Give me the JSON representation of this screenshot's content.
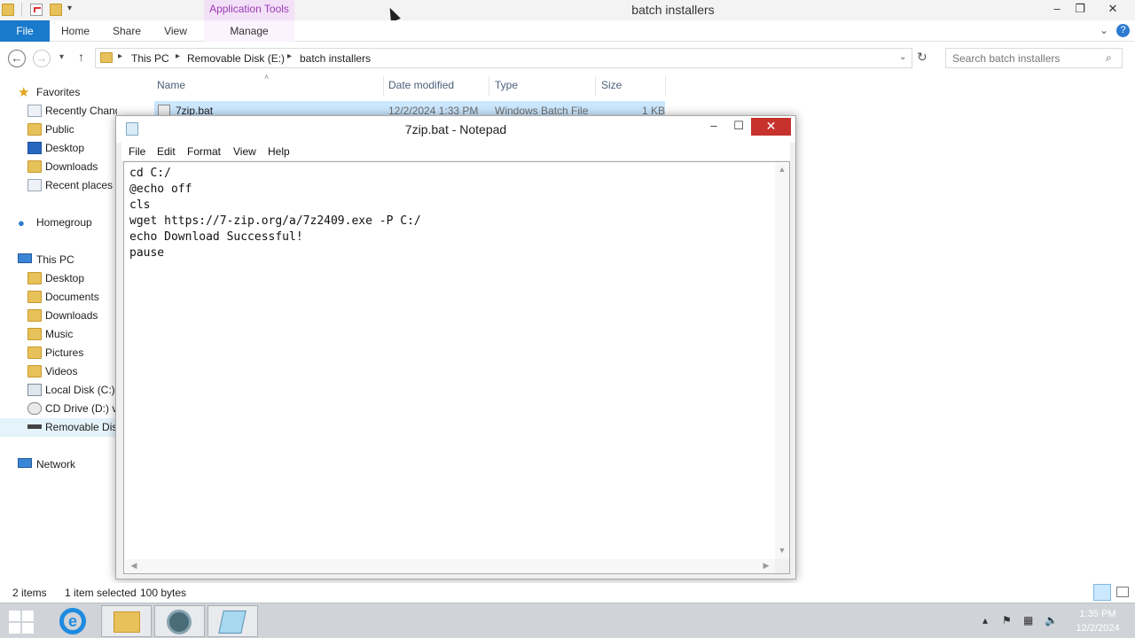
{
  "explorer": {
    "title": "batch installers",
    "context_tab": "Application Tools",
    "ribbon_tabs": {
      "file": "File",
      "home": "Home",
      "share": "Share",
      "view": "View",
      "manage": "Manage"
    },
    "breadcrumb": [
      "This PC",
      "Removable Disk (E:)",
      "batch installers"
    ],
    "search_placeholder": "Search batch installers",
    "nav": {
      "favorites": "Favorites",
      "recently_changed": "Recently Changed",
      "public": "Public",
      "desktop": "Desktop",
      "downloads": "Downloads",
      "recent_places": "Recent places",
      "homegroup": "Homegroup",
      "this_pc": "This PC",
      "pc_desktop": "Desktop",
      "documents": "Documents",
      "pc_downloads": "Downloads",
      "music": "Music",
      "pictures": "Pictures",
      "videos": "Videos",
      "local_disk": "Local Disk (C:)",
      "cd_drive": "CD Drive (D:) vi",
      "removable": "Removable Dis",
      "network": "Network"
    },
    "columns": {
      "name": "Name",
      "date_modified": "Date modified",
      "type": "Type",
      "size": "Size"
    },
    "file_row": {
      "name": "7zip.bat",
      "date": "12/2/2024 1:33 PM",
      "type": "Windows Batch File",
      "size": "1 KB"
    },
    "status": {
      "items": "2 items",
      "selected": "1 item selected",
      "bytes": "100 bytes"
    }
  },
  "notepad": {
    "title": "7zip.bat - Notepad",
    "menu": {
      "file": "File",
      "edit": "Edit",
      "format": "Format",
      "view": "View",
      "help": "Help"
    },
    "content": "cd C:/\n@echo off\ncls\nwget https://7-zip.org/a/7z2409.exe -P C:/\necho Download Successful!\npause"
  },
  "taskbar": {
    "time": "1:35 PM",
    "date": "12/2/2024",
    "accent": "#1979ca"
  }
}
